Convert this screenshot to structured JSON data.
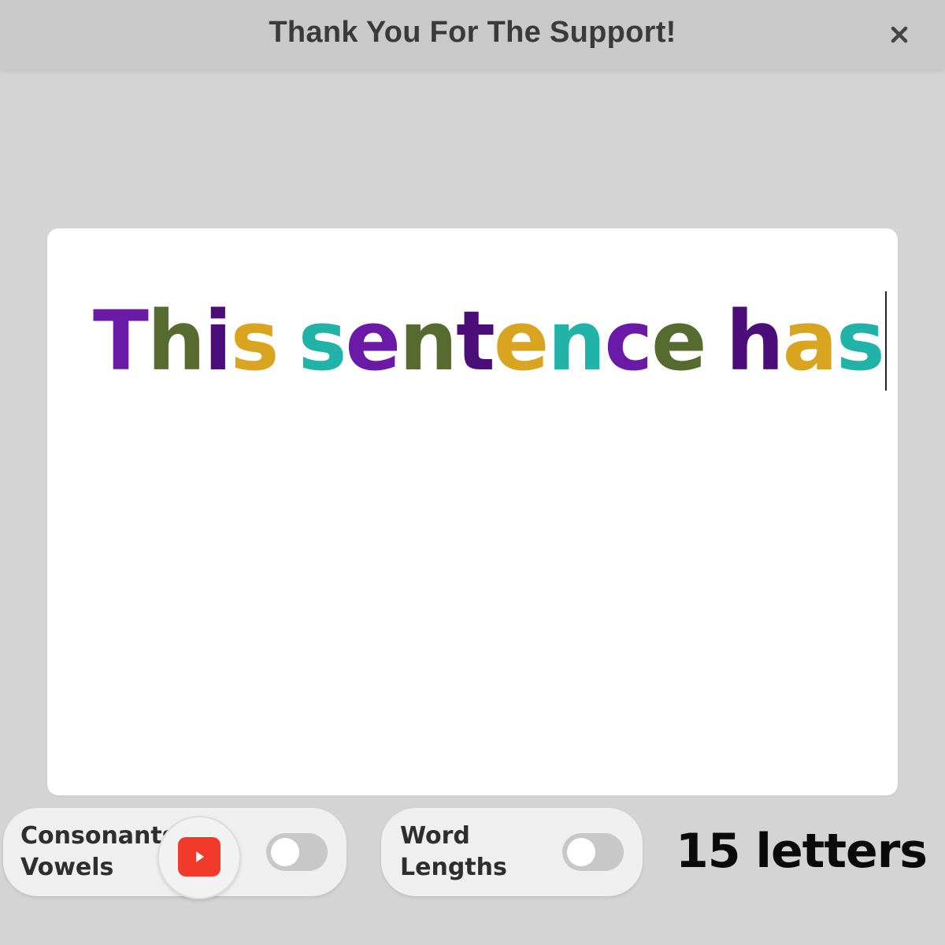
{
  "banner": {
    "title": "Thank You For The Support!",
    "close_icon": "close-icon"
  },
  "editor": {
    "characters": [
      {
        "ch": "T",
        "color": "#6b1aa8"
      },
      {
        "ch": "h",
        "color": "#556b2f"
      },
      {
        "ch": "i",
        "color": "#4b0d78"
      },
      {
        "ch": "s",
        "color": "#d9a521"
      },
      {
        "ch": " ",
        "color": "#000000"
      },
      {
        "ch": "s",
        "color": "#22b3a8"
      },
      {
        "ch": "e",
        "color": "#6b1aa8"
      },
      {
        "ch": "n",
        "color": "#556b2f"
      },
      {
        "ch": "t",
        "color": "#4b0d78"
      },
      {
        "ch": "e",
        "color": "#d9a521"
      },
      {
        "ch": "n",
        "color": "#22b3a8"
      },
      {
        "ch": "c",
        "color": "#6b1aa8"
      },
      {
        "ch": "e",
        "color": "#556b2f"
      },
      {
        "ch": " ",
        "color": "#000000"
      },
      {
        "ch": "h",
        "color": "#4b0d78"
      },
      {
        "ch": "a",
        "color": "#d9a521"
      },
      {
        "ch": "s",
        "color": "#22b3a8"
      }
    ]
  },
  "controls": {
    "consonants_label": "Consonants",
    "vowels_label": "Vowels",
    "consonants_vowels_toggle_on": false,
    "word_label": "Word",
    "lengths_label": "Lengths",
    "word_lengths_toggle_on": false,
    "video_icon": "youtube-play-icon",
    "letter_count": "15 letters"
  }
}
